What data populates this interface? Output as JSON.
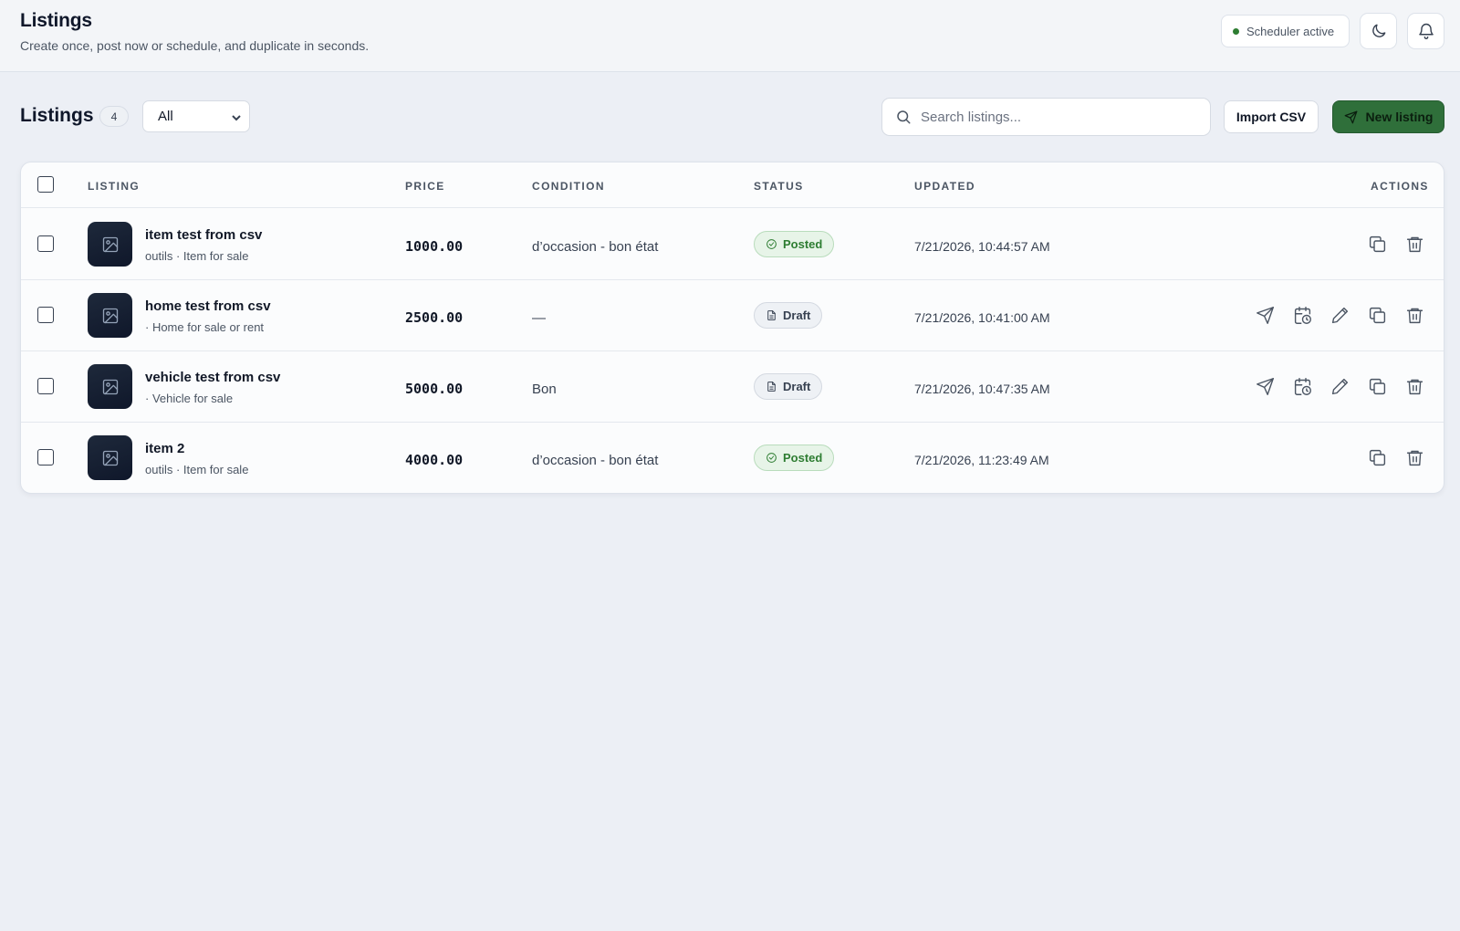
{
  "header": {
    "title": "Listings",
    "subtitle": "Create once, post now or schedule, and duplicate in seconds.",
    "scheduler_status": "Scheduler active",
    "theme_icon": "moon-icon",
    "notifications_icon": "bell-icon"
  },
  "toolbar": {
    "title": "Listings",
    "count": "4",
    "filter_value": "All",
    "search_placeholder": "Search listings...",
    "import_label": "Import CSV",
    "new_label": "New listing"
  },
  "table": {
    "columns": {
      "listing": "LISTING",
      "price": "PRICE",
      "condition": "CONDITION",
      "status": "STATUS",
      "updated": "UPDATED",
      "actions": "ACTIONS"
    },
    "rows": [
      {
        "name": "item test from csv",
        "subtitle": "outils · Item for sale",
        "price": "1000.00",
        "condition": "d’occasion - bon état",
        "status": "Posted",
        "updated": "7/21/2026, 10:44:57 AM",
        "actions": [
          "duplicate",
          "delete"
        ]
      },
      {
        "name": "home test from csv",
        "subtitle": "· Home for sale or rent",
        "price": "2500.00",
        "condition": "—",
        "status": "Draft",
        "updated": "7/21/2026, 10:41:00 AM",
        "actions": [
          "post",
          "schedule",
          "edit",
          "duplicate",
          "delete"
        ]
      },
      {
        "name": "vehicle test from csv",
        "subtitle": "· Vehicle for sale",
        "price": "5000.00",
        "condition": "Bon",
        "status": "Draft",
        "updated": "7/21/2026, 10:47:35 AM",
        "actions": [
          "post",
          "schedule",
          "edit",
          "duplicate",
          "delete"
        ]
      },
      {
        "name": "item 2",
        "subtitle": "outils · Item for sale",
        "price": "4000.00",
        "condition": "d’occasion - bon état",
        "status": "Posted",
        "updated": "7/21/2026, 11:23:49 AM",
        "actions": [
          "duplicate",
          "delete"
        ]
      }
    ]
  },
  "colors": {
    "accent": "#2f6f3a",
    "posted": "#2e7d32",
    "background": "#eceff5"
  }
}
